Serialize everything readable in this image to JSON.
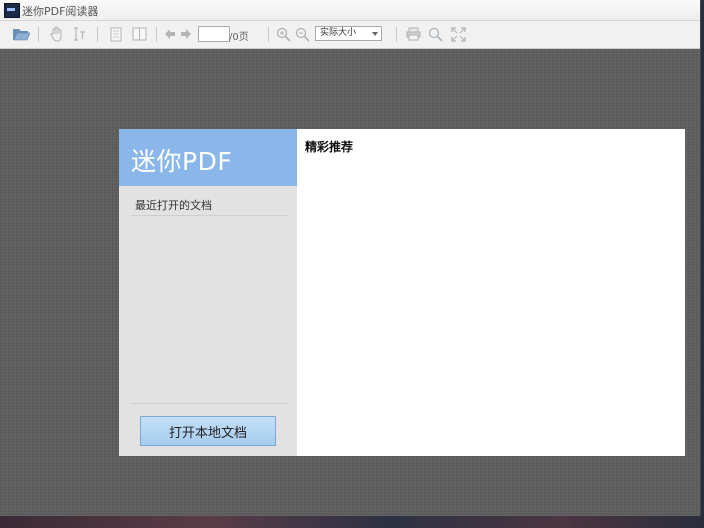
{
  "window": {
    "title": "迷你PDF阅读器"
  },
  "toolbar": {
    "icons": [
      "folder-open-icon",
      "hand-icon",
      "text-select-icon",
      "single-page-icon",
      "two-page-icon",
      "prev-arrow-icon",
      "next-arrow-icon",
      "zoom-in-icon",
      "zoom-out-icon",
      "print-icon",
      "search-icon",
      "fullscreen-icon"
    ],
    "page_value": "",
    "page_total": "/0页",
    "zoom_selected": "实际大小"
  },
  "sidebar": {
    "brand": "迷你PDF",
    "recent_label": "最近打开的文档",
    "open_button": "打开本地文档",
    "brand_color": "#8ab6ea"
  },
  "main": {
    "featured_label": "精彩推荐"
  }
}
